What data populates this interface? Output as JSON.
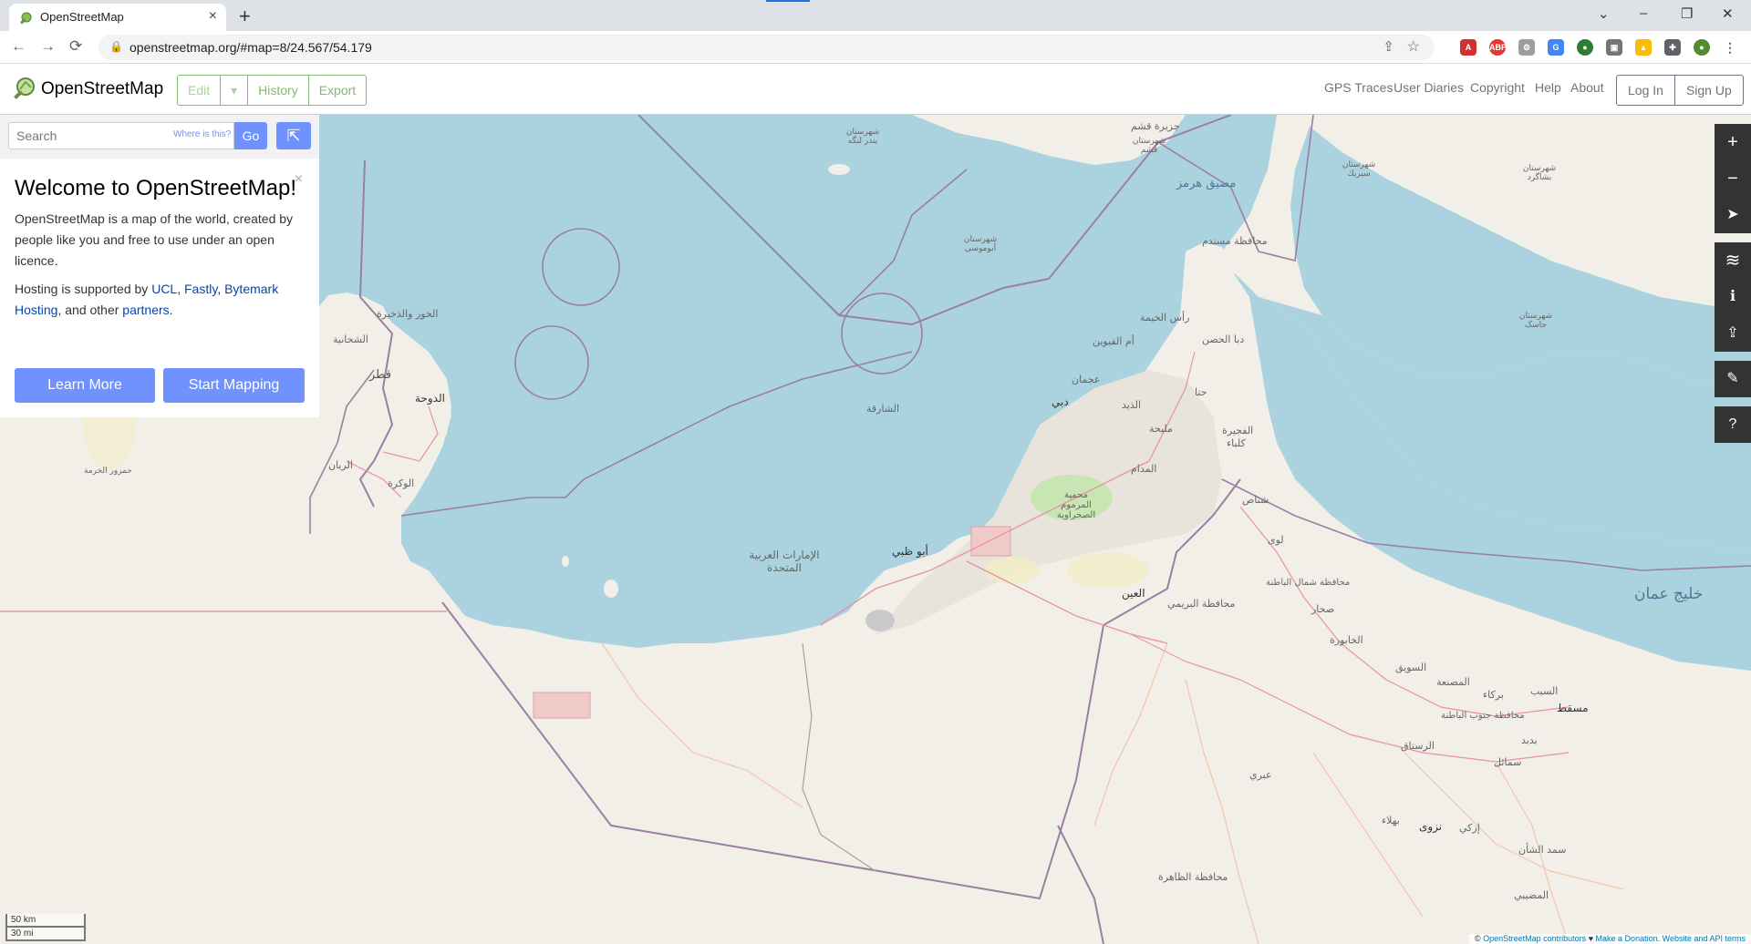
{
  "browser": {
    "tab_title": "OpenStreetMap",
    "tab_close": "×",
    "new_tab": "+",
    "url": "openstreetmap.org/#map=8/24.567/54.179",
    "back": "←",
    "forward": "→",
    "reload": "⟳",
    "minimize": "–",
    "maximize": "❐",
    "close": "✕",
    "tab_menu": "⌄"
  },
  "header": {
    "brand": "OpenStreetMap",
    "edit": "Edit",
    "edit_dropdown": "▾",
    "history": "History",
    "export": "Export",
    "links": [
      "GPS Traces",
      "User Diaries",
      "Copyright",
      "Help",
      "About"
    ],
    "login": "Log In",
    "signup": "Sign Up"
  },
  "search": {
    "placeholder": "Search",
    "where_is_this": "Where is this?",
    "go": "Go"
  },
  "welcome": {
    "close": "×",
    "title": "Welcome to OpenStreetMap!",
    "intro": "OpenStreetMap is a map of the world, created by people like you and free to use under an open licence.",
    "hosting_prefix": "Hosting is supported by ",
    "ucl": "UCL",
    "sep1": ", ",
    "fastly": "Fastly",
    "sep2": ", ",
    "bytemark": "Bytemark Hosting",
    "sep3": ", and other ",
    "partners": "partners",
    "end": ".",
    "learn_more": "Learn More",
    "start_mapping": "Start Mapping"
  },
  "map_controls": [
    "+",
    "−",
    "➤",
    "≋",
    "ℹ",
    "⇪",
    "✎",
    "?"
  ],
  "scale": {
    "km": "50 km",
    "mi": "30 mi"
  },
  "attribution": {
    "copy": "© ",
    "contributors": "OpenStreetMap contributors",
    "heart": " ♥ ",
    "donate": "Make a Donation",
    "dot": ". ",
    "terms": "Website and API terms"
  },
  "map_labels": {
    "doha": "الدوحة",
    "qatar": "قطر",
    "wakra": "الوكرة",
    "rayyan": "الريان",
    "khor": "الخور والذخيرة",
    "shamal": "الشحانية",
    "himrur": "حمرور الخرمة",
    "sharjah_sea": "الشارقة",
    "uae": "الإمارات العربية المتحدة",
    "abudhabi": "أبو ظبي",
    "dubai": "دبي",
    "ajman": "عجمان",
    "rak": "رأس الخيمة",
    "uaq": "أم القيوين",
    "fujairah": "الفجيرة",
    "kalba": "كلباء",
    "alain": "العين",
    "dibba": "دبا الحصن",
    "musandam": "محافظة مسندم",
    "hormuz": "مضيق هرمز",
    "qeshm": "جزيرة قشم",
    "muscat": "مسقط",
    "sohar": "صحار",
    "gulf_oman": "خليج عمان",
    "nizwa": "نزوى",
    "ibri": "عبري",
    "dhahira": "محافظة الظاهرة",
    "buraimi": "محافظة البريمي",
    "batinah_n": "محافظة شمال الباطنة",
    "batinah_s": "محافظة جنوب الباطنة",
    "rustaq": "الرستاق",
    "suwaiq": "السويق",
    "khaburah": "الخابورة",
    "mussanah": "المصنعة",
    "barka": "بركاء",
    "seeb": "السيب",
    "reserve": "محمية المرموم الصحراوية",
    "shinas": "شناص",
    "liwa": "لوى",
    "madam": "المدام",
    "mleiha": "مليحة",
    "dhaid": "الذيد",
    "hatta": "حتا",
    "abumusa": "شهرستان أبوموسى",
    "bandar": "شهرستان بندر لنگه",
    "qeshm_c": "شهرستان قشم",
    "minab": "شهرستان سيريك",
    "bashagard": "شهرستان بشاگرد",
    "jask": "شهرستان جاسک",
    "samail": "سمائل",
    "izki": "إزكي",
    "bahla": "بهلاء",
    "bidbid": "بدبد",
    "sharqiya": "سمد الشأن",
    "mudhaibi": "المضيبي"
  }
}
